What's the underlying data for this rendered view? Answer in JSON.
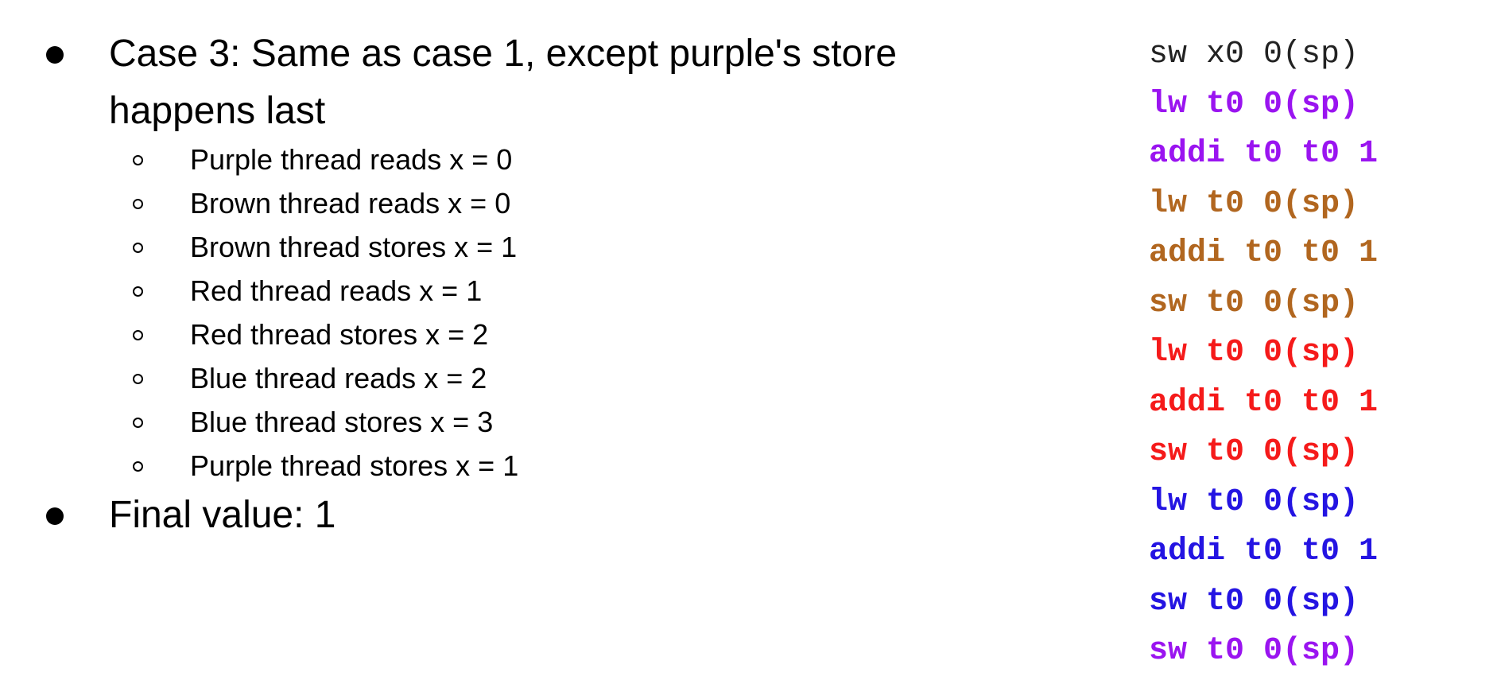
{
  "bullets": {
    "case_line1": "Case 3: Same as case 1, except purple's store",
    "case_line2": "happens last",
    "final": "Final value: 1"
  },
  "steps": [
    "Purple thread reads x = 0",
    "Brown thread reads x = 0",
    "Brown thread stores x = 1",
    "Red thread reads x = 1",
    "Red thread stores x = 2",
    "Blue thread reads x = 2",
    "Blue thread stores x = 3",
    "Purple thread stores x = 1"
  ],
  "colors": {
    "black": "#222222",
    "purple": "#9A14F0",
    "brown": "#B1661F",
    "red": "#F51A1A",
    "blue": "#2414E2"
  },
  "code": [
    {
      "text": "sw x0 0(sp)",
      "color": "#222222",
      "bold": false
    },
    {
      "text": "lw t0 0(sp)",
      "color": "#9A14F0",
      "bold": true
    },
    {
      "text": "addi t0 t0 1",
      "color": "#9A14F0",
      "bold": true
    },
    {
      "text": "lw t0 0(sp)",
      "color": "#B1661F",
      "bold": true
    },
    {
      "text": "addi t0 t0 1",
      "color": "#B1661F",
      "bold": true
    },
    {
      "text": "sw t0 0(sp)",
      "color": "#B1661F",
      "bold": true
    },
    {
      "text": "lw t0 0(sp)",
      "color": "#F51A1A",
      "bold": true
    },
    {
      "text": "addi t0 t0 1",
      "color": "#F51A1A",
      "bold": true
    },
    {
      "text": "sw t0 0(sp)",
      "color": "#F51A1A",
      "bold": true
    },
    {
      "text": "lw t0 0(sp)",
      "color": "#2414E2",
      "bold": true
    },
    {
      "text": "addi t0 t0 1",
      "color": "#2414E2",
      "bold": true
    },
    {
      "text": "sw t0 0(sp)",
      "color": "#2414E2",
      "bold": true
    },
    {
      "text": "sw t0 0(sp)",
      "color": "#9A14F0",
      "bold": true
    }
  ]
}
